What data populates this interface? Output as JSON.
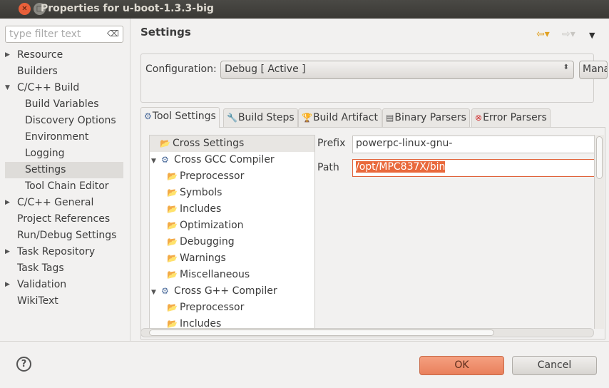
{
  "window": {
    "title": "Properties for u-boot-1.3.3-big"
  },
  "filter": {
    "placeholder": "type filter text"
  },
  "nav": [
    {
      "label": "Resource",
      "level": 0,
      "arrow": "▶"
    },
    {
      "label": "Builders",
      "level": 0,
      "arrow": ""
    },
    {
      "label": "C/C++ Build",
      "level": 0,
      "arrow": "▼"
    },
    {
      "label": "Build Variables",
      "level": 1,
      "arrow": ""
    },
    {
      "label": "Discovery Options",
      "level": 1,
      "arrow": ""
    },
    {
      "label": "Environment",
      "level": 1,
      "arrow": ""
    },
    {
      "label": "Logging",
      "level": 1,
      "arrow": ""
    },
    {
      "label": "Settings",
      "level": 1,
      "arrow": "",
      "selected": true
    },
    {
      "label": "Tool Chain Editor",
      "level": 1,
      "arrow": ""
    },
    {
      "label": "C/C++ General",
      "level": 0,
      "arrow": "▶"
    },
    {
      "label": "Project References",
      "level": 0,
      "arrow": ""
    },
    {
      "label": "Run/Debug Settings",
      "level": 0,
      "arrow": ""
    },
    {
      "label": "Task Repository",
      "level": 0,
      "arrow": "▶"
    },
    {
      "label": "Task Tags",
      "level": 0,
      "arrow": ""
    },
    {
      "label": "Validation",
      "level": 0,
      "arrow": "▶"
    },
    {
      "label": "WikiText",
      "level": 0,
      "arrow": ""
    }
  ],
  "main": {
    "title": "Settings",
    "config_label": "Configuration:",
    "config_value": "Debug  [ Active ]",
    "manage_label": "Manage Configurations...",
    "tabs": [
      {
        "label": "Tool Settings",
        "icon": "gear-icon",
        "glyph": "⚙",
        "color": "#4a6a9a"
      },
      {
        "label": "Build Steps",
        "icon": "wrench-icon",
        "glyph": "🔧",
        "color": "#6a7a9a"
      },
      {
        "label": "Build Artifact",
        "icon": "trophy-icon",
        "glyph": "🏆",
        "color": "#d0a020"
      },
      {
        "label": "Binary Parsers",
        "icon": "binary-icon",
        "glyph": "▤",
        "color": "#555555"
      },
      {
        "label": "Error Parsers",
        "icon": "error-icon",
        "glyph": "⊗",
        "color": "#d03030"
      }
    ],
    "tree": [
      {
        "label": "Cross Settings",
        "indent": 1,
        "icon": "folder",
        "selected": true
      },
      {
        "label": "Cross GCC Compiler",
        "indent": 0,
        "icon": "gear",
        "arrow": "▼"
      },
      {
        "label": "Preprocessor",
        "indent": 2,
        "icon": "folder"
      },
      {
        "label": "Symbols",
        "indent": 2,
        "icon": "folder"
      },
      {
        "label": "Includes",
        "indent": 2,
        "icon": "folder"
      },
      {
        "label": "Optimization",
        "indent": 2,
        "icon": "folder"
      },
      {
        "label": "Debugging",
        "indent": 2,
        "icon": "folder"
      },
      {
        "label": "Warnings",
        "indent": 2,
        "icon": "folder"
      },
      {
        "label": "Miscellaneous",
        "indent": 2,
        "icon": "folder"
      },
      {
        "label": "Cross G++ Compiler",
        "indent": 0,
        "icon": "gear",
        "arrow": "▼"
      },
      {
        "label": "Preprocessor",
        "indent": 2,
        "icon": "folder"
      },
      {
        "label": "Includes",
        "indent": 2,
        "icon": "folder"
      }
    ],
    "prefix_label": "Prefix",
    "prefix_value": "powerpc-linux-gnu-",
    "path_label": "Path",
    "path_value": "/opt/MPC837X/bin"
  },
  "buttons": {
    "ok": "OK",
    "cancel": "Cancel",
    "help": "?"
  },
  "colors": {
    "accent": "#e9693c",
    "ok_button": "#e9805c",
    "titlebar": "#3c3b37"
  }
}
